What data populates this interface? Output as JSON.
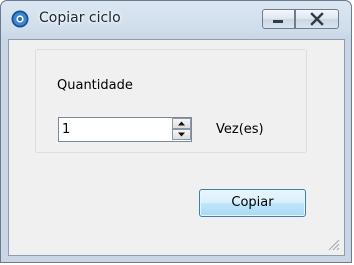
{
  "window": {
    "title": "Copiar ciclo",
    "app_icon": "round-app-icon",
    "controls": {
      "minimize_icon": "minimize-icon",
      "close_icon": "close-icon"
    }
  },
  "form": {
    "group_label": "Quantidade",
    "quantity": {
      "value": "1",
      "up_icon": "spin-up-arrow-icon",
      "down_icon": "spin-down-arrow-icon"
    },
    "unit_label": "Vez(es)",
    "copy_button_label": "Copiar"
  },
  "colors": {
    "accent_button_border": "#3c7fb1",
    "title_gradient_top": "#dce7f3",
    "client_background": "#f0f0f0"
  }
}
